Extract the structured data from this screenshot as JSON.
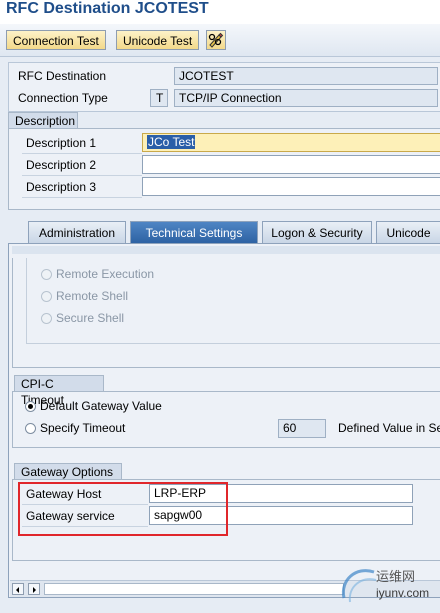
{
  "title": "RFC Destination JCOTEST",
  "toolbar": {
    "connection_test": "Connection Test",
    "unicode_test": "Unicode Test",
    "extra_icon": "pencil-glasses-icon"
  },
  "header": {
    "rfc_destination_label": "RFC Destination",
    "rfc_destination_value": "JCOTEST",
    "connection_type_label": "Connection Type",
    "connection_type_code": "T",
    "connection_type_value": "TCP/IP Connection"
  },
  "description": {
    "group_title": "Description",
    "desc1_label": "Description 1",
    "desc1_value": "JCo Test",
    "desc2_label": "Description 2",
    "desc2_value": "",
    "desc3_label": "Description 3",
    "desc3_value": ""
  },
  "tabs": [
    {
      "label": "Administration",
      "active": false
    },
    {
      "label": "Technical Settings",
      "active": true
    },
    {
      "label": "Logon & Security",
      "active": false
    },
    {
      "label": "Unicode",
      "active": false
    }
  ],
  "activation": {
    "remote_execution": "Remote Execution",
    "remote_shell": "Remote Shell",
    "secure_shell": "Secure Shell"
  },
  "cpic_timeout": {
    "group_title": "CPI-C Timeout",
    "default_gateway": "Default Gateway Value",
    "specify_timeout": "Specify Timeout",
    "timeout_value": "60",
    "defined_value_label": "Defined Value in Se"
  },
  "gateway": {
    "group_title": "Gateway Options",
    "host_label": "Gateway Host",
    "host_value": "LRP-ERP",
    "service_label": "Gateway service",
    "service_value": "sapgw00"
  },
  "watermark": {
    "cn_text": "运维网",
    "url_text": "iyunv.com"
  },
  "colors": {
    "highlight_border": "#e0262b",
    "active_tab": "#2d62a3",
    "selected_field": "#fdf0b8"
  }
}
